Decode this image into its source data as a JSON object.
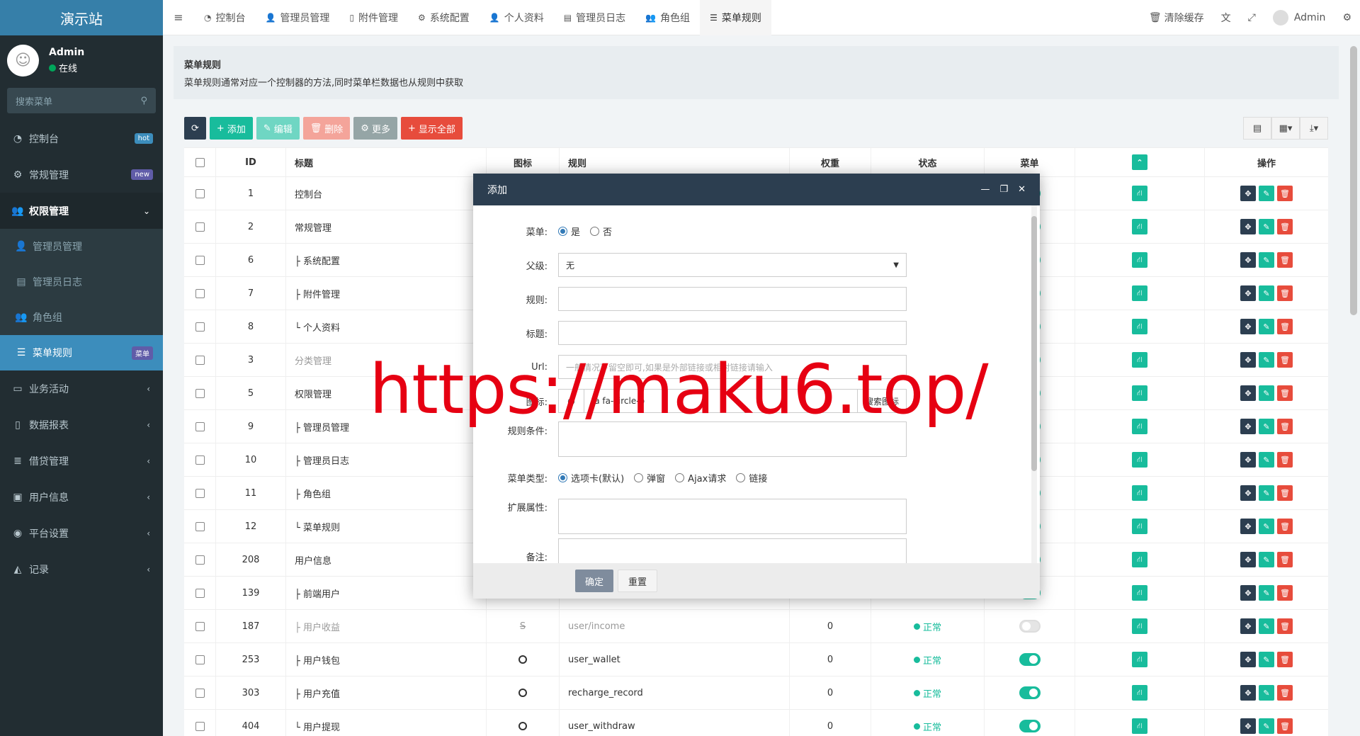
{
  "sidebar": {
    "logo": "演示站",
    "user": {
      "name": "Admin",
      "status": "在线"
    },
    "search_placeholder": "搜索菜单",
    "items": [
      {
        "label": "控制台",
        "icon": "dashboard-icon",
        "tag": "hot",
        "tag_color": "#3c8dbc"
      },
      {
        "label": "常规管理",
        "icon": "cogs-icon",
        "tag": "new",
        "tag_color": "#605ca8"
      },
      {
        "label": "权限管理",
        "icon": "group-icon",
        "open": true
      }
    ],
    "sub_items": [
      {
        "label": "管理员管理",
        "icon": "user-icon"
      },
      {
        "label": "管理员日志",
        "icon": "list-alt-icon"
      },
      {
        "label": "角色组",
        "icon": "group-icon"
      },
      {
        "label": "菜单规则",
        "icon": "bars-icon",
        "tag": "菜单",
        "active": true
      }
    ],
    "more_items": [
      {
        "label": "业务活动",
        "icon": "credit-card-icon"
      },
      {
        "label": "数据报表",
        "icon": "file-text-icon"
      },
      {
        "label": "借贷管理",
        "icon": "list-icon"
      },
      {
        "label": "用户信息",
        "icon": "id-card-icon"
      },
      {
        "label": "平台设置",
        "icon": "dot-circle-icon"
      },
      {
        "label": "记录",
        "icon": "area-chart-icon"
      }
    ]
  },
  "topbar": {
    "tabs": [
      "控制台",
      "管理员管理",
      "附件管理",
      "系统配置",
      "个人资料",
      "管理员日志",
      "角色组",
      "菜单规则"
    ],
    "clear_cache": "清除缓存",
    "user": "Admin"
  },
  "panel": {
    "title": "菜单规则",
    "desc": "菜单规则通常对应一个控制器的方法,同时菜单栏数据也从规则中获取"
  },
  "toolbar": {
    "add": "添加",
    "edit": "编辑",
    "del": "删除",
    "more": "更多",
    "show_all": "显示全部",
    "colors": {
      "refresh": "#2c3e50",
      "add": "#18bc9c",
      "edit": "#6fd6c3",
      "del": "#f4a49a",
      "more": "#95a5a6",
      "show_all": "#e74c3c"
    }
  },
  "table": {
    "headers": [
      "ID",
      "标题",
      "图标",
      "规则",
      "权重",
      "状态",
      "菜单",
      "操作"
    ],
    "rows": [
      {
        "id": "1",
        "title": "控制台"
      },
      {
        "id": "2",
        "title": "常规管理"
      },
      {
        "id": "6",
        "title": "├ 系统配置"
      },
      {
        "id": "7",
        "title": "├ 附件管理"
      },
      {
        "id": "8",
        "title": "└ 个人资料"
      },
      {
        "id": "3",
        "title": "分类管理",
        "muted": true
      },
      {
        "id": "5",
        "title": "权限管理"
      },
      {
        "id": "9",
        "title": "├ 管理员管理"
      },
      {
        "id": "10",
        "title": "├ 管理员日志"
      },
      {
        "id": "11",
        "title": "├ 角色组"
      },
      {
        "id": "12",
        "title": "└ 菜单规则"
      },
      {
        "id": "208",
        "title": "用户信息"
      },
      {
        "id": "139",
        "title": "├ 前端用户"
      },
      {
        "id": "187",
        "title": "├ 用户收益",
        "muted": true,
        "icon": "strike-s-icon",
        "rule": "user/income",
        "weight": "0",
        "status": "正常",
        "menu": false
      },
      {
        "id": "253",
        "title": "├ 用户钱包",
        "icon": "circle-o-icon",
        "rule": "user_wallet",
        "weight": "0",
        "status": "正常",
        "menu": true
      },
      {
        "id": "303",
        "title": "├ 用户充值",
        "icon": "circle-o-icon",
        "rule": "recharge_record",
        "weight": "0",
        "status": "正常",
        "menu": true
      },
      {
        "id": "404",
        "title": "└ 用户提现",
        "icon": "circle-o-icon",
        "rule": "user_withdraw",
        "weight": "0",
        "status": "正常",
        "menu": true
      }
    ]
  },
  "modal": {
    "title": "添加",
    "labels": {
      "menu": "菜单:",
      "parent": "父级:",
      "rule": "规则:",
      "title": "标题:",
      "url": "Url:",
      "icon": "图标:",
      "condition": "规则条件:",
      "menu_type": "菜单类型:",
      "ext": "扩展属性:",
      "remark": "备注:"
    },
    "menu_yes": "是",
    "menu_no": "否",
    "parent_value": "无",
    "url_placeholder": "一般情况下留空即可,如果是外部链接或相对链接请输入",
    "icon_value": "fa fa-circle-o",
    "icon_search": "搜索图标",
    "menu_types": [
      "选项卡(默认)",
      "弹窗",
      "Ajax请求",
      "链接"
    ],
    "ok": "确定",
    "reset": "重置"
  },
  "watermark": "https://maku6.top/"
}
